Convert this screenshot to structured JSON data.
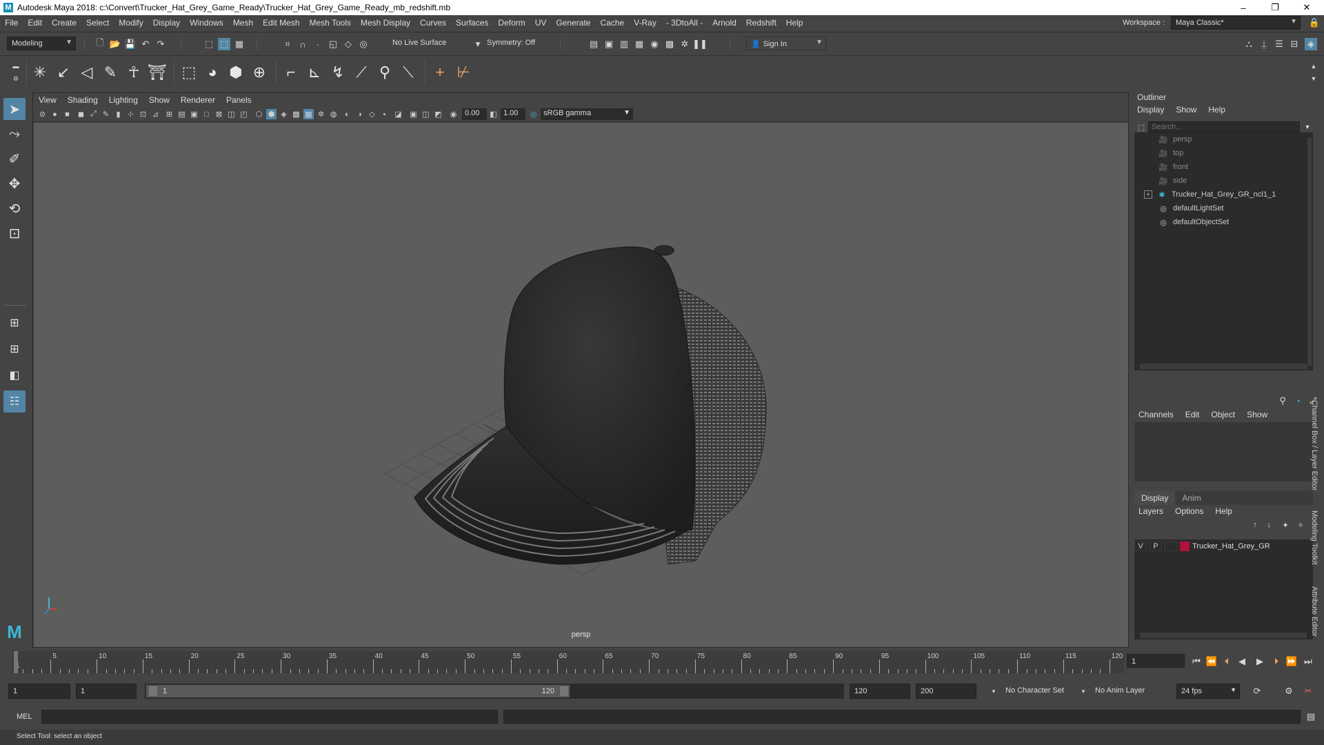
{
  "titlebar": {
    "icon": "M",
    "title": "Autodesk Maya 2018: c:\\Convert\\Trucker_Hat_Grey_Game_Ready\\Trucker_Hat_Grey_Game_Ready_mb_redshift.mb",
    "minimize": "–",
    "maximize": "❐",
    "close": "✕"
  },
  "menubar": {
    "items": [
      "File",
      "Edit",
      "Create",
      "Select",
      "Modify",
      "Display",
      "Windows",
      "Mesh",
      "Edit Mesh",
      "Mesh Tools",
      "Mesh Display",
      "Curves",
      "Surfaces",
      "Deform",
      "UV",
      "Generate",
      "Cache",
      "V-Ray",
      "- 3DtoAll -",
      "Arnold",
      "Redshift",
      "Help"
    ],
    "workspace_label": "Workspace :",
    "workspace_value": "Maya Classic*"
  },
  "statusbar": {
    "mode": "Modeling",
    "live_surface": "No Live Surface",
    "symmetry": "Symmetry: Off",
    "sign_in": "Sign In"
  },
  "viewport": {
    "menu": [
      "View",
      "Shading",
      "Lighting",
      "Show",
      "Renderer",
      "Panels"
    ],
    "exposure": "0.00",
    "gamma": "1.00",
    "color_space": "sRGB gamma",
    "camera_label": "persp"
  },
  "outliner": {
    "title": "Outliner",
    "menu": [
      "Display",
      "Show",
      "Help"
    ],
    "search_placeholder": "Search...",
    "items": [
      {
        "label": "persp",
        "dim": true
      },
      {
        "label": "top",
        "dim": true
      },
      {
        "label": "front",
        "dim": true
      },
      {
        "label": "side",
        "dim": true
      },
      {
        "label": "Trucker_Hat_Grey_GR_ncl1_1",
        "dim": false
      },
      {
        "label": "defaultLightSet",
        "dim": false
      },
      {
        "label": "defaultObjectSet",
        "dim": false
      }
    ]
  },
  "channelbox": {
    "menu": [
      "Channels",
      "Edit",
      "Object",
      "Show"
    ]
  },
  "layereditor": {
    "tabs": [
      "Display",
      "Anim"
    ],
    "menu": [
      "Layers",
      "Options",
      "Help"
    ],
    "layer": {
      "v": "V",
      "p": "P",
      "name": "Trucker_Hat_Grey_GR",
      "color": "#b0123a"
    }
  },
  "sidetabs": [
    "Channel Box / Layer Editor",
    "Modeling Toolkit",
    "Attribute Editor"
  ],
  "timeline": {
    "ticks": [
      1,
      5,
      10,
      15,
      20,
      25,
      30,
      35,
      40,
      45,
      50,
      55,
      60,
      65,
      70,
      75,
      80,
      85,
      90,
      95,
      100,
      105,
      110,
      115,
      120
    ],
    "current_frame": "1"
  },
  "range": {
    "start": "1",
    "anim_start": "1",
    "slider_start": "1",
    "slider_end": "120",
    "end": "120",
    "anim_end": "200",
    "character_set": "No Character Set",
    "anim_layer": "No Anim Layer",
    "fps": "24 fps"
  },
  "cmdline": {
    "label": "MEL"
  },
  "status": {
    "help": "Select Tool: select an object"
  }
}
